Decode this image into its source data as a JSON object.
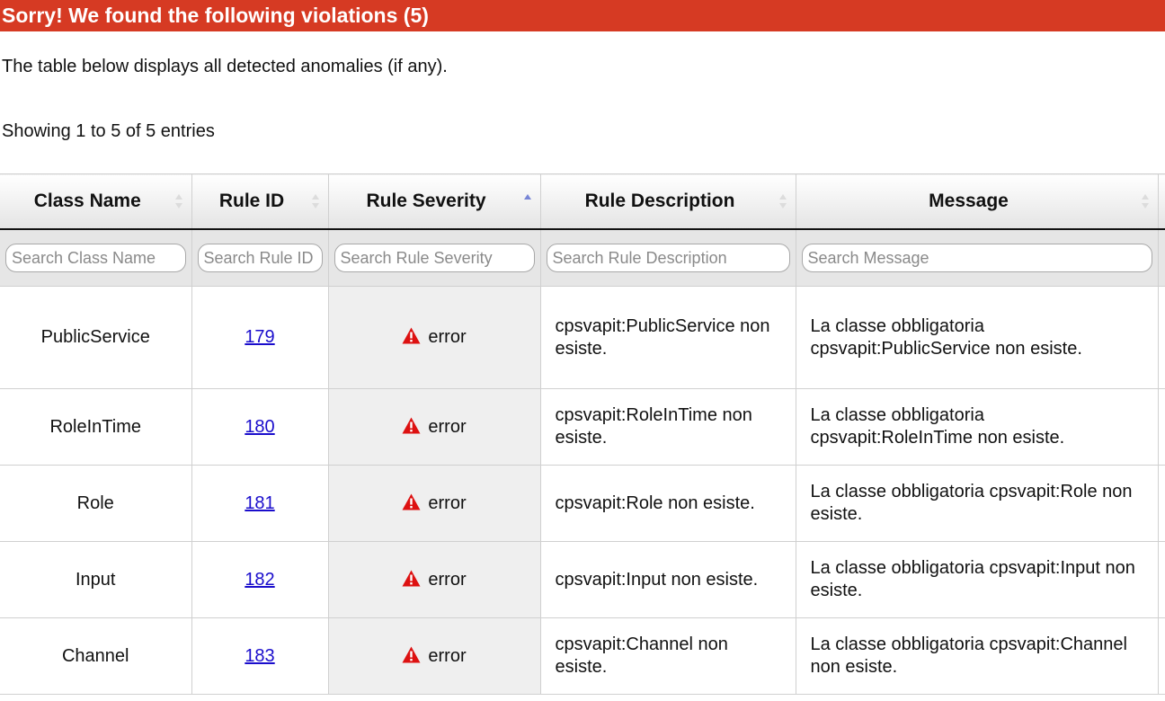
{
  "banner": {
    "title": "Sorry! We found the following violations (5)"
  },
  "intro": {
    "text": "The table below displays all detected anomalies (if any)."
  },
  "info": {
    "text": "Showing 1 to 5 of 5 entries"
  },
  "colors": {
    "banner": "#d63a23",
    "link": "#1a0dcc",
    "warning": "#dd1111",
    "sort_active": "#7785d6"
  },
  "table": {
    "columns": [
      {
        "label": "Class Name",
        "sort": "none",
        "placeholder": "Search Class Name"
      },
      {
        "label": "Rule ID",
        "sort": "none",
        "placeholder": "Search Rule ID"
      },
      {
        "label": "Rule Severity",
        "sort": "ascending",
        "placeholder": "Search Rule Severity"
      },
      {
        "label": "Rule Description",
        "sort": "none",
        "placeholder": "Search Rule Description"
      },
      {
        "label": "Message",
        "sort": "none",
        "placeholder": "Search Message"
      }
    ],
    "rows": [
      {
        "class_name": "PublicService",
        "rule_id": "179",
        "severity_icon": "warning-triangle-icon",
        "severity": "error",
        "description": "cpsvapit:PublicService non esiste.",
        "message": "La classe obbligatoria cpsvapit:PublicService non esiste."
      },
      {
        "class_name": "RoleInTime",
        "rule_id": "180",
        "severity_icon": "warning-triangle-icon",
        "severity": "error",
        "description": "cpsvapit:RoleInTime non esiste.",
        "message": "La classe obbligatoria cpsvapit:RoleInTime non esiste."
      },
      {
        "class_name": "Role",
        "rule_id": "181",
        "severity_icon": "warning-triangle-icon",
        "severity": "error",
        "description": "cpsvapit:Role non esiste.",
        "message": "La classe obbligatoria cpsvapit:Role non esiste."
      },
      {
        "class_name": "Input",
        "rule_id": "182",
        "severity_icon": "warning-triangle-icon",
        "severity": "error",
        "description": "cpsvapit:Input non esiste.",
        "message": "La classe obbligatoria cpsvapit:Input non esiste."
      },
      {
        "class_name": "Channel",
        "rule_id": "183",
        "severity_icon": "warning-triangle-icon",
        "severity": "error",
        "description": "cpsvapit:Channel non esiste.",
        "message": "La classe obbligatoria cpsvapit:Channel non esiste."
      }
    ]
  }
}
